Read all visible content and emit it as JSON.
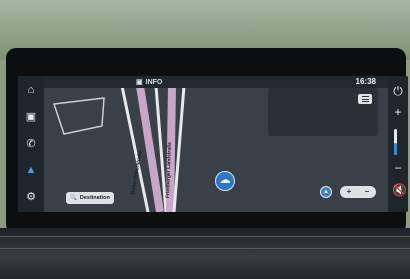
{
  "status_bar": {
    "info_label": "INFO",
    "clock": "16:38"
  },
  "sidebar": {
    "items": [
      {
        "id": "home",
        "icon": "home-icon"
      },
      {
        "id": "media",
        "icon": "radio-icon"
      },
      {
        "id": "phone",
        "icon": "phone-icon"
      },
      {
        "id": "navigation",
        "icon": "navigation-arrow-icon",
        "active": true
      },
      {
        "id": "settings",
        "icon": "gear-icon"
      }
    ]
  },
  "map": {
    "destination_placeholder": "Destination",
    "roads": [
      "Dottenfelderstraße",
      "Friedberger Landstraße"
    ]
  },
  "rightbar": {
    "power": "power-icon",
    "volume_up": "+",
    "volume_down": "−",
    "volume_level": 0.45,
    "mute": "mute-icon"
  },
  "zoom": {
    "in": "+",
    "out": "−"
  },
  "colors": {
    "accent": "#2b78c4",
    "screen_bg": "#2b3137",
    "road": "#c8a6c8"
  }
}
